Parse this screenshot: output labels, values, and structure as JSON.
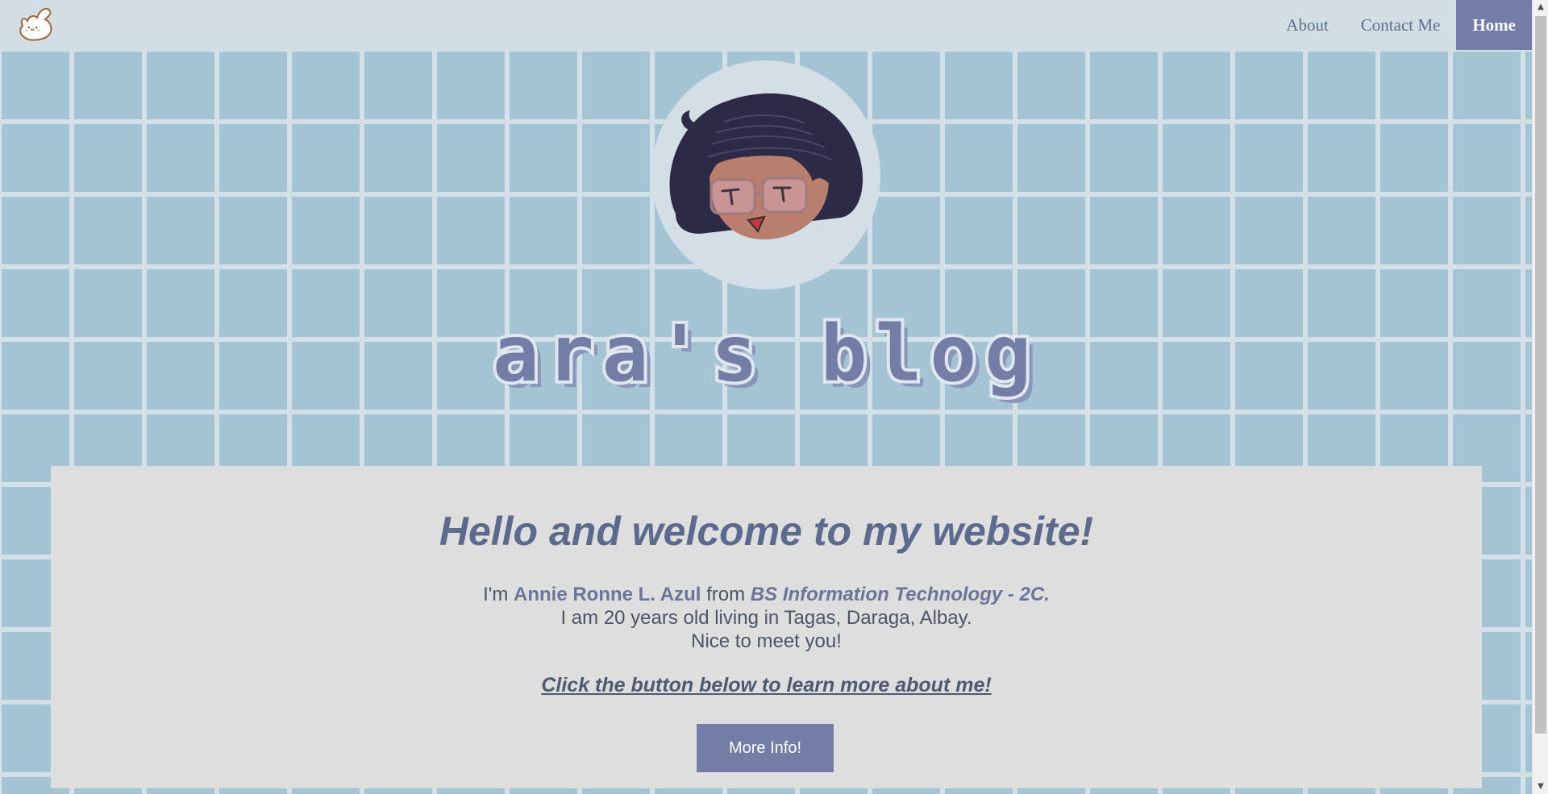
{
  "nav": {
    "logo": "bunny-logo",
    "links": [
      {
        "label": "About"
      },
      {
        "label": "Contact Me"
      },
      {
        "label": "Home",
        "active": true
      }
    ]
  },
  "hero": {
    "avatar": "girl-with-glasses-avatar",
    "title": "ara's blog"
  },
  "card": {
    "welcome": "Hello and welcome to my website!",
    "intro_prefix": "I'm ",
    "name": "Annie Ronne L. Azul",
    "intro_from": " from ",
    "course": "BS Information Technology - 2C.",
    "line2": "I am 20 years old living in Tagas, Daraga, Albay.",
    "line3": "Nice to meet you!",
    "cta": "Click the button below to learn more about me!",
    "button": "More Info!"
  },
  "colors": {
    "accent": "#737da6",
    "background": "#a4c4d4",
    "grid_lines": "#d3e0e8",
    "nav_bg": "#d3dde4",
    "card_bg": "#dedede",
    "heading": "#5b6a8d"
  }
}
